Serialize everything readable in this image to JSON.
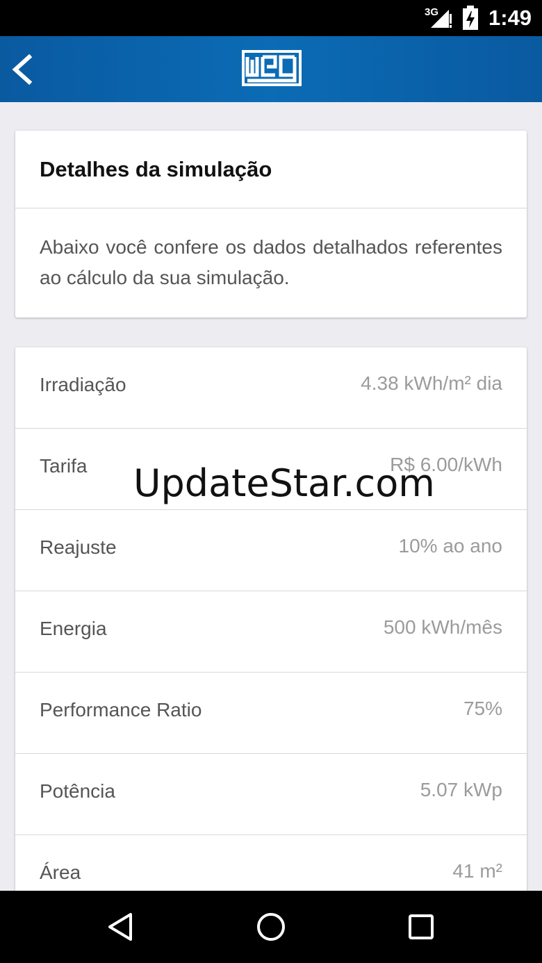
{
  "status_bar": {
    "network": "3G",
    "time": "1:49"
  },
  "app_bar": {
    "back_icon": "chevron-left-icon",
    "logo_text": "WEG",
    "brand_color": "#0b6bb5"
  },
  "intro_card": {
    "title": "Detalhes da simulação",
    "description": "Abaixo você confere os dados detalhados referentes ao cálculo da sua simulação."
  },
  "details": [
    {
      "label": "Irradiação",
      "value": "4.38 kWh/m² dia"
    },
    {
      "label": "Tarifa",
      "value": "R$ 6.00/kWh"
    },
    {
      "label": "Reajuste",
      "value": "10% ao ano"
    },
    {
      "label": "Energia",
      "value": "500 kWh/mês"
    },
    {
      "label": "Performance Ratio",
      "value": "75%"
    },
    {
      "label": "Potência",
      "value": "5.07 kWp"
    },
    {
      "label": "Área",
      "value": "41 m²"
    }
  ],
  "watermark": "UpdateStar.com",
  "nav_bar": {
    "back": "triangle-back-icon",
    "home": "circle-home-icon",
    "recents": "square-recents-icon"
  }
}
